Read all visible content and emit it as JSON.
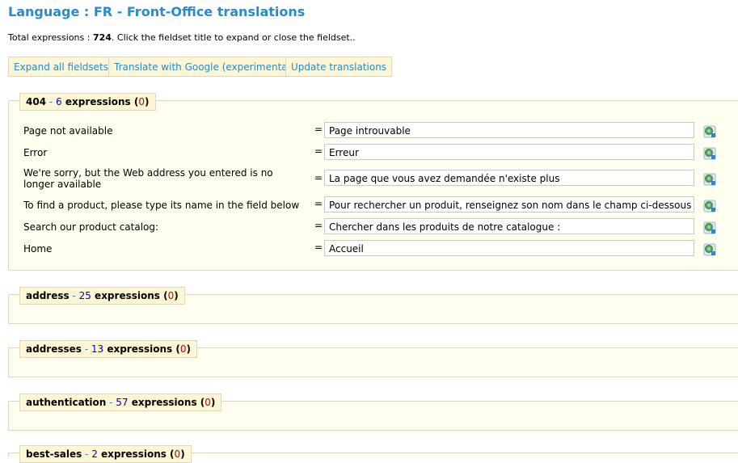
{
  "page": {
    "title": "Language : FR - Front-Office translations",
    "total_prefix": "Total expressions : ",
    "total_count": "724",
    "total_suffix": ". Click the fieldset title to expand or close the fieldset.."
  },
  "toolbar": {
    "expand_label": "Expand all fieldsets",
    "google_label": "Translate with Google (experimental)",
    "update_label": "Update translations"
  },
  "fieldsets": [
    {
      "name": "404",
      "sep": " - ",
      "count": "6",
      "word": " expressions (",
      "missing": "0",
      "close": ")",
      "rows": [
        {
          "label": "Page not available",
          "eq": "=",
          "value": "Page introuvable"
        },
        {
          "label": "Error",
          "eq": "=",
          "value": "Erreur"
        },
        {
          "label": "We're sorry, but the Web address you entered is no longer available",
          "eq": "=",
          "value": "La page que vous avez demandée n'existe plus"
        },
        {
          "label": "To find a product, please type its name in the field below",
          "eq": "=",
          "value": "Pour rechercher un produit, renseignez son nom dans le champ ci-dessous"
        },
        {
          "label": "Search our product catalog:",
          "eq": "=",
          "value": "Chercher dans les produits de notre catalogue :"
        },
        {
          "label": "Home",
          "eq": "=",
          "value": "Accueil"
        }
      ]
    },
    {
      "name": "address",
      "sep": " - ",
      "count": "25",
      "word": " expressions (",
      "missing": "0",
      "close": ")"
    },
    {
      "name": "addresses",
      "sep": " - ",
      "count": "13",
      "word": " expressions (",
      "missing": "0",
      "close": ")"
    },
    {
      "name": "authentication",
      "sep": " - ",
      "count": "57",
      "word": " expressions (",
      "missing": "0",
      "close": ")"
    },
    {
      "name": "best-sales",
      "sep": " - ",
      "count": "2",
      "word": " expressions (",
      "missing": "0",
      "close": ")"
    }
  ],
  "icons": {
    "translate": "google-translate-icon"
  },
  "colors": {
    "accent": "#268ccd",
    "legend_bg": "#fff6d3",
    "fieldset_bg": "#fffff0",
    "count": "#0000cc",
    "missing": "#cc0000"
  }
}
